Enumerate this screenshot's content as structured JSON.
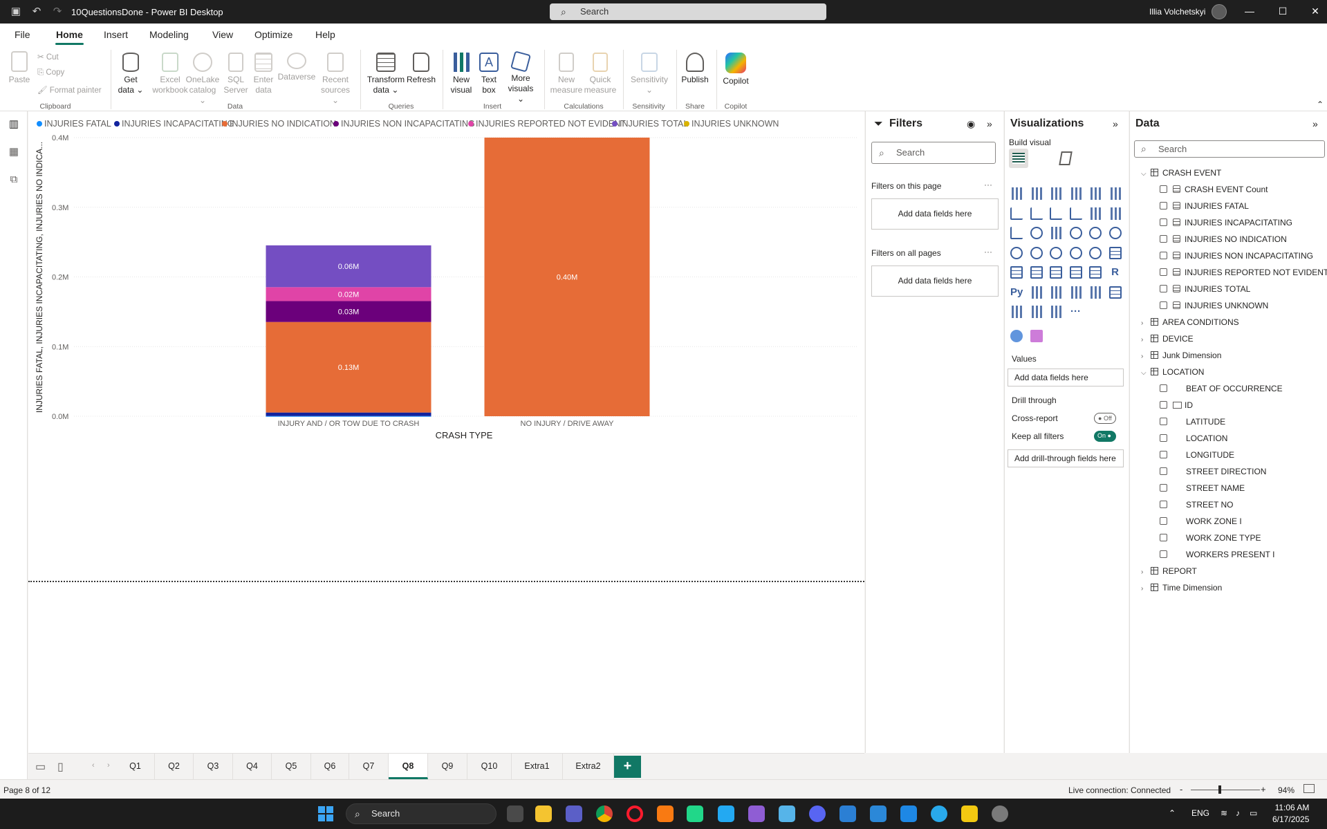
{
  "titlebar": {
    "doc_title": "10QuestionsDone - Power BI Desktop",
    "search_placeholder": "Search",
    "user_name": "Illia Volchetskyi"
  },
  "menu": [
    "File",
    "Home",
    "Insert",
    "Modeling",
    "View",
    "Optimize",
    "Help"
  ],
  "ribbon": {
    "clipboard": {
      "paste": "Paste",
      "cut": "Cut",
      "copy": "Copy",
      "format_painter": "Format painter",
      "group": "Clipboard"
    },
    "data": {
      "get_data": [
        "Get",
        "data"
      ],
      "excel": [
        "Excel",
        "workbook"
      ],
      "onelake": [
        "OneLake",
        "catalog"
      ],
      "sql": [
        "SQL",
        "Server"
      ],
      "enter": [
        "Enter",
        "data"
      ],
      "dataverse": "Dataverse",
      "recent": [
        "Recent",
        "sources"
      ],
      "group": "Data"
    },
    "queries": {
      "transform": [
        "Transform",
        "data"
      ],
      "refresh": "Refresh",
      "group": "Queries"
    },
    "insert": {
      "new_visual": [
        "New",
        "visual"
      ],
      "text_box": [
        "Text",
        "box"
      ],
      "more_visuals": [
        "More",
        "visuals"
      ],
      "group": "Insert"
    },
    "calculations": {
      "new_measure": [
        "New",
        "measure"
      ],
      "quick_measure": [
        "Quick",
        "measure"
      ],
      "group": "Calculations"
    },
    "sensitivity": {
      "label": "Sensitivity",
      "group": "Sensitivity"
    },
    "share": {
      "publish": "Publish",
      "group": "Share"
    },
    "copilot": {
      "label": "Copilot",
      "group": "Copilot"
    }
  },
  "chart_data": {
    "type": "bar",
    "stacked": true,
    "legend": [
      {
        "name": "INJURIES FATAL",
        "color": "#118DFF"
      },
      {
        "name": "INJURIES INCAPACITATING",
        "color": "#12239E"
      },
      {
        "name": "INJURIES NO INDICATION",
        "color": "#E66C37"
      },
      {
        "name": "INJURIES NON INCAPACITATING",
        "color": "#6B007B"
      },
      {
        "name": "INJURIES REPORTED NOT EVIDENT",
        "color": "#E044A7"
      },
      {
        "name": "INJURIES TOTAL",
        "color": "#744EC2"
      },
      {
        "name": "INJURIES UNKNOWN",
        "color": "#D9B300"
      }
    ],
    "categories": [
      "INJURY AND / OR TOW DUE TO CRASH",
      "NO INJURY / DRIVE AWAY"
    ],
    "series": [
      {
        "name": "INJURIES FATAL",
        "values": [
          0.0003,
          0
        ]
      },
      {
        "name": "INJURIES INCAPACITATING",
        "values": [
          0.005,
          0
        ]
      },
      {
        "name": "INJURIES NO INDICATION",
        "values": [
          0.13,
          0.4
        ]
      },
      {
        "name": "INJURIES NON INCAPACITATING",
        "values": [
          0.03,
          0
        ]
      },
      {
        "name": "INJURIES REPORTED NOT EVIDENT",
        "values": [
          0.02,
          0
        ]
      },
      {
        "name": "INJURIES TOTAL",
        "values": [
          0.06,
          0
        ]
      },
      {
        "name": "INJURIES UNKNOWN",
        "values": [
          0,
          0
        ]
      }
    ],
    "data_labels": [
      {
        "category": 0,
        "series": 2,
        "text": "0.13M"
      },
      {
        "category": 0,
        "series": 3,
        "text": "0.03M"
      },
      {
        "category": 0,
        "series": 4,
        "text": "0.02M"
      },
      {
        "category": 0,
        "series": 5,
        "text": "0.06M"
      },
      {
        "category": 1,
        "series": 2,
        "text": "0.40M"
      }
    ],
    "yticks": [
      "0.0M",
      "0.1M",
      "0.2M",
      "0.3M",
      "0.4M"
    ],
    "ylim": [
      0,
      0.4
    ],
    "ylabel": "INJURIES FATAL, INJURIES INCAPACITATING, INJURIES NO INDICA...",
    "xlabel": "CRASH TYPE",
    "grid": true,
    "legend_position": "top-left"
  },
  "filters": {
    "title": "Filters",
    "search_placeholder": "Search",
    "this_page": "Filters on this page",
    "all_pages": "Filters on all pages",
    "add_fields": "Add data fields here",
    "more": "···"
  },
  "visualizations": {
    "title": "Visualizations",
    "build_visual": "Build visual",
    "values_label": "Values",
    "add_fields": "Add data fields here",
    "drill_through": "Drill through",
    "cross_report": "Cross-report",
    "cross_report_state": "Off",
    "keep_filters": "Keep all filters",
    "keep_filters_state": "On",
    "add_drill": "Add drill-through fields here",
    "icons": [
      "stacked-bar-icon",
      "clustered-column-icon",
      "clustered-bar-icon",
      "stacked-column-icon",
      "100-bar-icon",
      "100-column-icon",
      "line-chart-icon",
      "area-chart-icon",
      "stacked-area-icon",
      "ribbon-chart-icon",
      "waterfall-icon",
      "combo-chart-icon",
      "line-column-icon",
      "scatter-icon",
      "funnel-icon",
      "scatter-plot-icon",
      "pie-icon",
      "donut-icon",
      "treemap-icon",
      "map-icon",
      "filled-map-icon",
      "azure-map-icon",
      "gauge-icon",
      "card-icon",
      "multi-row-card-icon",
      "kpi-icon",
      "slicer-icon",
      "table-icon",
      "matrix-icon",
      "r-visual-icon",
      "python-visual-icon",
      "key-influencers-icon",
      "decomposition-tree-icon",
      "qa-icon",
      "narrative-icon",
      "paginated-icon",
      "power-apps-icon",
      "power-automate-icon",
      "goals-icon",
      "more-visuals-icon"
    ],
    "r_label": "R",
    "py_label": "Py",
    "more_label": "···"
  },
  "data": {
    "title": "Data",
    "search_placeholder": "Search",
    "tables": [
      {
        "name": "CRASH EVENT",
        "expanded": true,
        "fields": [
          {
            "name": "CRASH EVENT Count",
            "kind": "measure"
          },
          {
            "name": "INJURIES FATAL",
            "kind": "measure"
          },
          {
            "name": "INJURIES INCAPACITATING",
            "kind": "measure"
          },
          {
            "name": "INJURIES NO INDICATION",
            "kind": "measure"
          },
          {
            "name": "INJURIES NON INCAPACITATING",
            "kind": "measure"
          },
          {
            "name": "INJURIES REPORTED NOT EVIDENT",
            "kind": "measure"
          },
          {
            "name": "INJURIES TOTAL",
            "kind": "measure"
          },
          {
            "name": "INJURIES UNKNOWN",
            "kind": "measure"
          }
        ]
      },
      {
        "name": "AREA CONDITIONS",
        "expanded": false,
        "fields": []
      },
      {
        "name": "DEVICE",
        "expanded": false,
        "fields": []
      },
      {
        "name": "Junk Dimension",
        "expanded": false,
        "fields": []
      },
      {
        "name": "LOCATION",
        "expanded": true,
        "fields": [
          {
            "name": "BEAT OF OCCURRENCE",
            "kind": "column"
          },
          {
            "name": "ID",
            "kind": "id"
          },
          {
            "name": "LATITUDE",
            "kind": "column"
          },
          {
            "name": "LOCATION",
            "kind": "column"
          },
          {
            "name": "LONGITUDE",
            "kind": "column"
          },
          {
            "name": "STREET DIRECTION",
            "kind": "column"
          },
          {
            "name": "STREET NAME",
            "kind": "column"
          },
          {
            "name": "STREET NO",
            "kind": "column"
          },
          {
            "name": "WORK ZONE I",
            "kind": "column"
          },
          {
            "name": "WORK ZONE TYPE",
            "kind": "column"
          },
          {
            "name": "WORKERS PRESENT I",
            "kind": "column"
          }
        ]
      },
      {
        "name": "REPORT",
        "expanded": false,
        "fields": []
      },
      {
        "name": "Time Dimension",
        "expanded": false,
        "fields": []
      }
    ]
  },
  "pages": {
    "tabs": [
      "Q1",
      "Q2",
      "Q3",
      "Q4",
      "Q5",
      "Q6",
      "Q7",
      "Q8",
      "Q9",
      "Q10",
      "Extra1",
      "Extra2"
    ],
    "active": "Q8",
    "add": "+"
  },
  "status": {
    "page_info": "Page 8 of 12",
    "connection": "Live connection: Connected",
    "zoom": "94%",
    "zoom_minus": "-",
    "zoom_plus": "+"
  },
  "taskbar": {
    "search": "Search",
    "lang": "ENG",
    "time": "11:06 AM",
    "date": "6/17/2025"
  },
  "colors": {
    "accent": "#117865",
    "canvas_bg": "#FFFFFF"
  }
}
